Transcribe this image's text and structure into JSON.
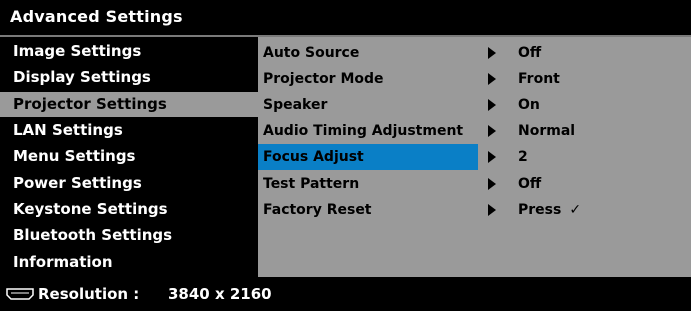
{
  "window": {
    "title": "Advanced Settings"
  },
  "sidebar": {
    "items": [
      {
        "label": "Image Settings",
        "selected": false
      },
      {
        "label": "Display Settings",
        "selected": false
      },
      {
        "label": "Projector Settings",
        "selected": true
      },
      {
        "label": "LAN Settings",
        "selected": false
      },
      {
        "label": "Menu Settings",
        "selected": false
      },
      {
        "label": "Power Settings",
        "selected": false
      },
      {
        "label": "Keystone Settings",
        "selected": false
      },
      {
        "label": "Bluetooth Settings",
        "selected": false
      },
      {
        "label": "Information",
        "selected": false
      }
    ]
  },
  "settings": {
    "rows": [
      {
        "label": "Auto Source",
        "value": "Off"
      },
      {
        "label": "Projector Mode",
        "value": "Front"
      },
      {
        "label": "Speaker",
        "value": "On"
      },
      {
        "label": "Audio Timing Adjustment",
        "value": "Normal"
      },
      {
        "label": "Focus Adjust",
        "value": "2",
        "highlighted": true
      },
      {
        "label": "Test Pattern",
        "value": "Off"
      },
      {
        "label": "Factory Reset",
        "value": "Press",
        "check": "✓"
      }
    ]
  },
  "footer": {
    "icon": "hdmi-port-icon",
    "resolution_label": "Resolution :",
    "resolution_value": "3840 x 2160"
  },
  "colors": {
    "panel_gray": "#9a9a9a",
    "highlight_blue": "#0a7fc6",
    "background": "#000000",
    "text_light": "#ffffff"
  }
}
